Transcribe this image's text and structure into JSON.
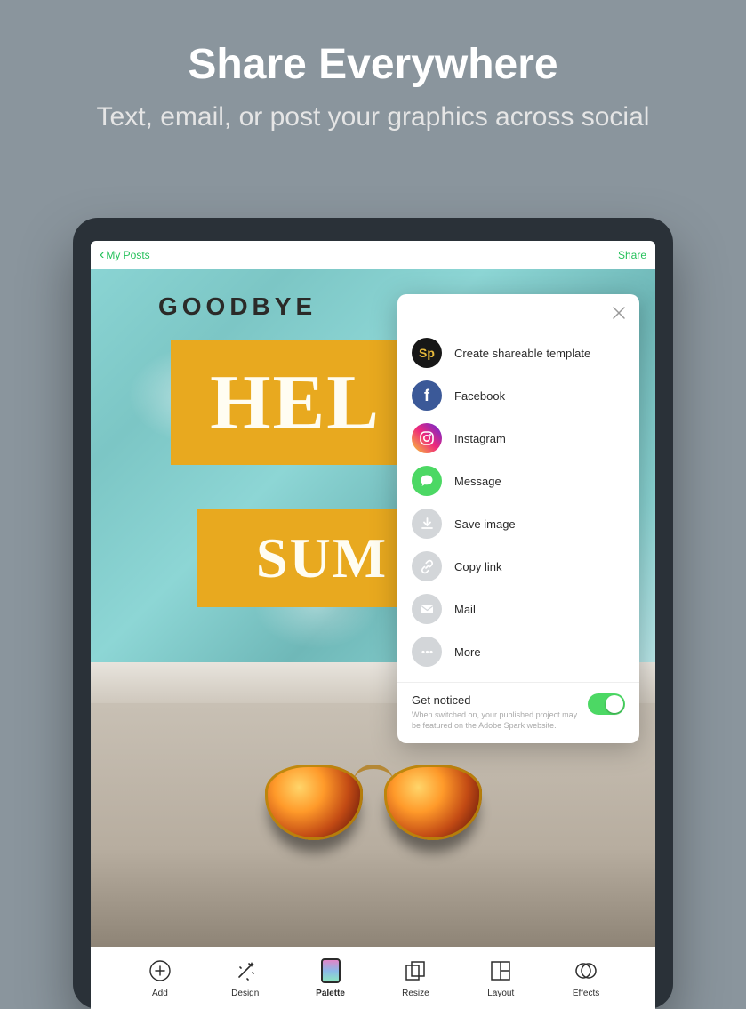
{
  "promo": {
    "title": "Share Everywhere",
    "subtitle": "Text, email, or post your graphics across social"
  },
  "header": {
    "back_label": "My Posts",
    "share_label": "Share"
  },
  "canvas": {
    "goodbye": "GOODBYE",
    "hello": "HEL",
    "summer": "SUM"
  },
  "share_options": [
    {
      "id": "template",
      "label": "Create shareable template",
      "icon": "sp"
    },
    {
      "id": "facebook",
      "label": "Facebook",
      "icon": "fb"
    },
    {
      "id": "instagram",
      "label": "Instagram",
      "icon": "ig"
    },
    {
      "id": "message",
      "label": "Message",
      "icon": "msg"
    },
    {
      "id": "save",
      "label": "Save image",
      "icon": "download"
    },
    {
      "id": "copy",
      "label": "Copy link",
      "icon": "link"
    },
    {
      "id": "mail",
      "label": "Mail",
      "icon": "mail"
    },
    {
      "id": "more",
      "label": "More",
      "icon": "more"
    }
  ],
  "get_noticed": {
    "title": "Get noticed",
    "description": "When switched on, your published project may be featured on the Adobe Spark website.",
    "enabled": true
  },
  "toolbar": [
    {
      "id": "add",
      "label": "Add",
      "selected": false
    },
    {
      "id": "design",
      "label": "Design",
      "selected": false
    },
    {
      "id": "palette",
      "label": "Palette",
      "selected": true
    },
    {
      "id": "resize",
      "label": "Resize",
      "selected": false
    },
    {
      "id": "layout",
      "label": "Layout",
      "selected": false
    },
    {
      "id": "effects",
      "label": "Effects",
      "selected": false
    }
  ]
}
